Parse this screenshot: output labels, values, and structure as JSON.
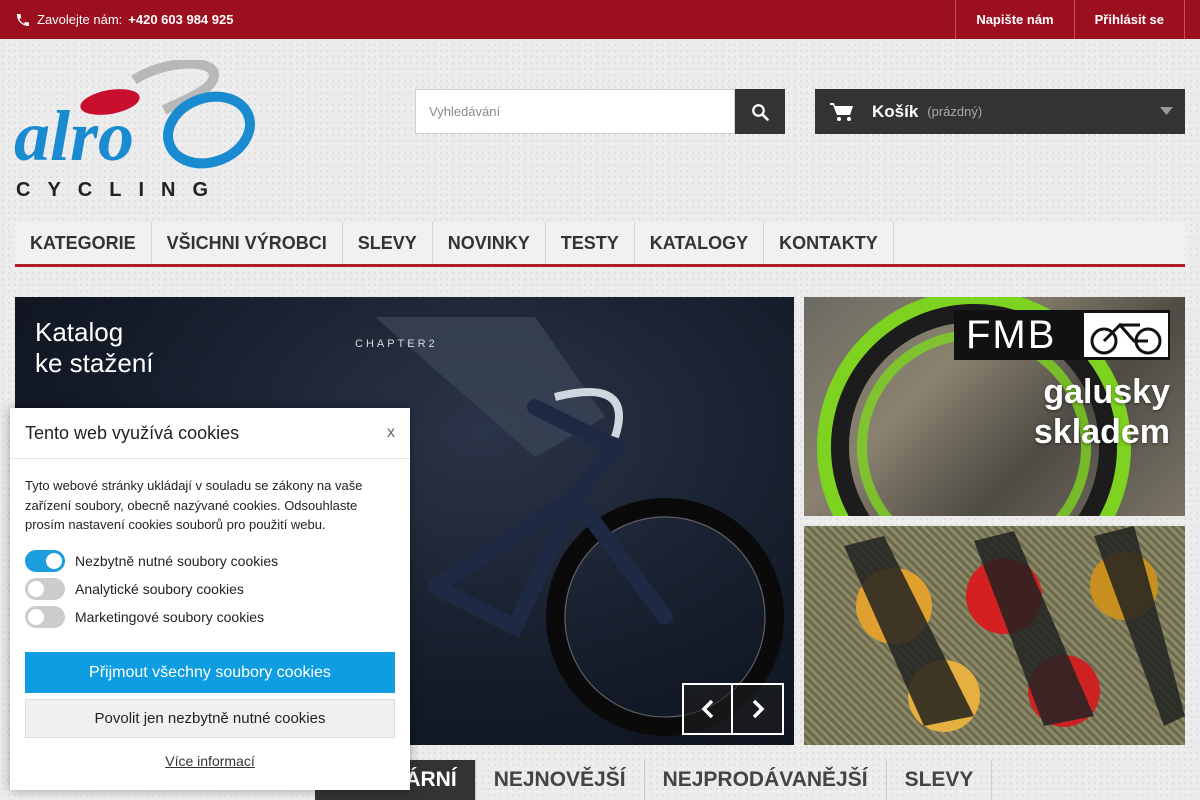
{
  "topbar": {
    "call_label": "Zavolejte nám:",
    "phone": "+420 603 984 925",
    "contact_link": "Napište nám",
    "login_link": "Přihlásit se",
    "bg_color": "#9b0f1f"
  },
  "logo": {
    "word": "alro",
    "sub": "CYCLING"
  },
  "search": {
    "placeholder": "Vyhledávání"
  },
  "cart": {
    "title": "Košík",
    "status": "(prázdný)"
  },
  "menu": {
    "items": [
      "Kategorie",
      "Všichni výrobci",
      "Slevy",
      "Novinky",
      "Testy",
      "Katalogy",
      "Kontakty"
    ]
  },
  "slider": {
    "caption_line1": "Katalog",
    "caption_line2": "ke stažení",
    "brand_text": "CHAPTER2"
  },
  "banner1": {
    "brand": "FMB",
    "line1": "galusky",
    "line2": "skladem"
  },
  "tabs": {
    "items": [
      "Populární",
      "Nejnovější",
      "Nejprodávanější",
      "Slevy"
    ],
    "active_partial": "ARNÍ"
  },
  "cookie": {
    "title": "Tento web využívá cookies",
    "close": "x",
    "description": "Tyto webové stránky ukládají v souladu se zákony na vaše zařízení soubory, obecně nazývané cookies. Odsouhlaste prosím nastavení cookies souborů pro použití webu.",
    "options": [
      {
        "label": "Nezbytně nutné soubory cookies",
        "on": true
      },
      {
        "label": "Analytické soubory cookies",
        "on": false
      },
      {
        "label": "Marketingové soubory cookies",
        "on": false
      }
    ],
    "accept_all": "Přijmout všechny soubory cookies",
    "necessary_only": "Povolit jen nezbytně nutné cookies",
    "more": "Více informací",
    "accent": "#0d9de0"
  }
}
